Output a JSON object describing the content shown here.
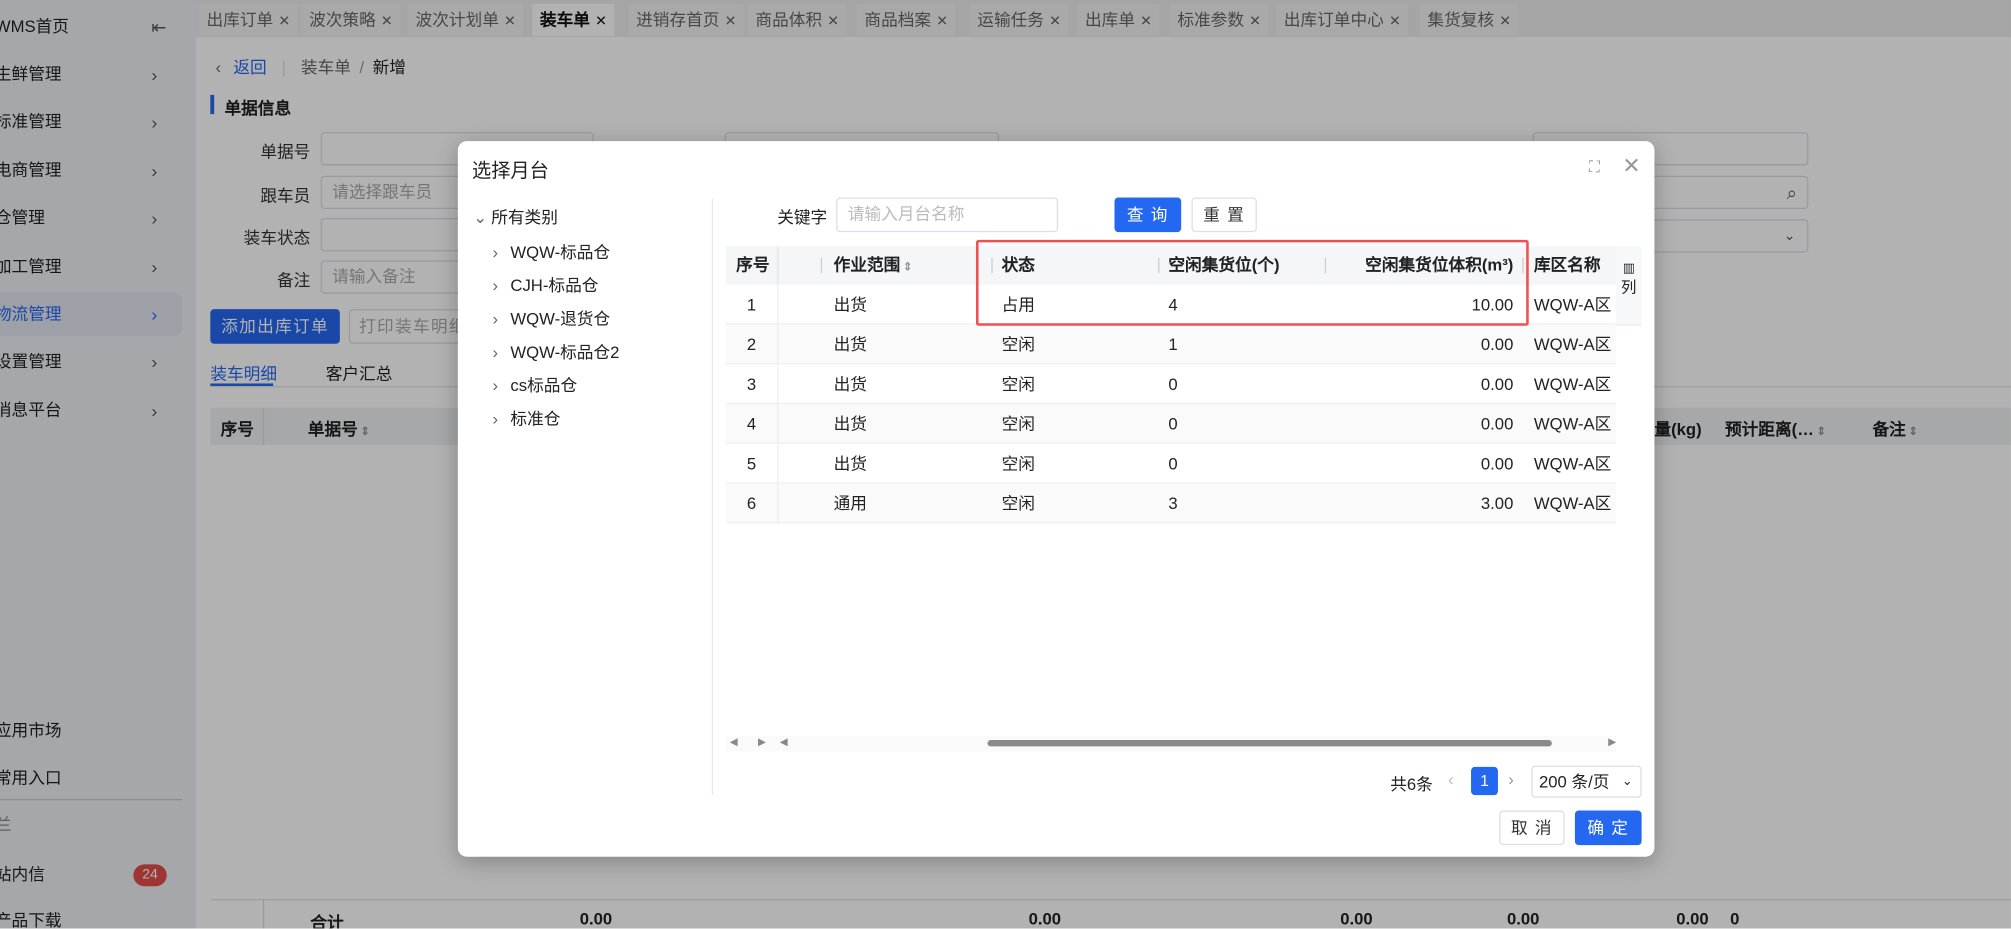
{
  "sidebar": {
    "home": "WMS首页",
    "items": [
      {
        "label": "生鲜管理"
      },
      {
        "label": "标准管理"
      },
      {
        "label": "电商管理"
      },
      {
        "label": "仓管理"
      },
      {
        "label": "加工管理"
      },
      {
        "label": "物流管理"
      },
      {
        "label": "设置管理"
      },
      {
        "label": "消息平台"
      }
    ],
    "bottom": [
      {
        "label": "应用市场"
      },
      {
        "label": "常用入口"
      },
      {
        "label": "兰"
      },
      {
        "label": "站内信",
        "badge": "24"
      },
      {
        "label": "产品下载"
      }
    ]
  },
  "tabs": [
    {
      "label": "出库订单"
    },
    {
      "label": "波次策略"
    },
    {
      "label": "波次计划单"
    },
    {
      "label": "装车单"
    },
    {
      "label": "进销存首页"
    },
    {
      "label": "商品体积"
    },
    {
      "label": "商品档案"
    },
    {
      "label": "运输任务"
    },
    {
      "label": "出库单"
    },
    {
      "label": "标准参数"
    },
    {
      "label": "出库订单中心"
    },
    {
      "label": "集货复核"
    }
  ],
  "breadcrumb": {
    "back": "返回",
    "parent": "装车单",
    "sep": "/",
    "current": "新增"
  },
  "form": {
    "section_title": "单据信息",
    "labels": [
      "单据号",
      "跟车员",
      "装车状态",
      "备注"
    ],
    "placeholders": {
      "follower": "请选择跟车员",
      "remark": "请输入备注"
    }
  },
  "actions": {
    "add_order": "添加出库订单",
    "print": "打印装车明细"
  },
  "subtabs": [
    "装车明细",
    "客户汇总"
  ],
  "bg_table": {
    "headers": [
      "序号",
      "单据号",
      "量(kg)",
      "预计距离(…",
      "备注"
    ],
    "total_label": "合计",
    "totals": [
      "0.00",
      "0.00",
      "0.00",
      "0.00",
      "0.00",
      "0"
    ]
  },
  "modal": {
    "title": "选择月台",
    "tree": {
      "root": "所有类别",
      "children": [
        "WQW-标品仓",
        "CJH-标品仓",
        "WQW-退货仓",
        "WQW-标品仓2",
        "cs标品仓",
        "标准仓"
      ]
    },
    "keyword_label": "关键字",
    "keyword_placeholder": "请输入月台名称",
    "search_btn": "查 询",
    "reset_btn": "重 置",
    "columns": [
      "序号",
      "作业范围",
      "状态",
      "空闲集货位(个)",
      "空闲集货位体积(m³)",
      "库区名称"
    ],
    "col_setting": "列",
    "rows": [
      {
        "no": "1",
        "scope": "出货",
        "status": "占用",
        "free": "4",
        "volume": "10.00",
        "area": "WQW-A区"
      },
      {
        "no": "2",
        "scope": "出货",
        "status": "空闲",
        "free": "1",
        "volume": "0.00",
        "area": "WQW-A区"
      },
      {
        "no": "3",
        "scope": "出货",
        "status": "空闲",
        "free": "0",
        "volume": "0.00",
        "area": "WQW-A区"
      },
      {
        "no": "4",
        "scope": "出货",
        "status": "空闲",
        "free": "0",
        "volume": "0.00",
        "area": "WQW-A区"
      },
      {
        "no": "5",
        "scope": "出货",
        "status": "空闲",
        "free": "0",
        "volume": "0.00",
        "area": "WQW-A区"
      },
      {
        "no": "6",
        "scope": "通用",
        "status": "空闲",
        "free": "3",
        "volume": "3.00",
        "area": "WQW-A区"
      }
    ],
    "pagination": {
      "total": "共6条",
      "page": "1",
      "page_size": "200 条/页"
    },
    "cancel": "取 消",
    "confirm": "确 定"
  },
  "colors": {
    "primary": "#2468f2",
    "highlight": "#f05050",
    "badge": "#e24b4b"
  }
}
